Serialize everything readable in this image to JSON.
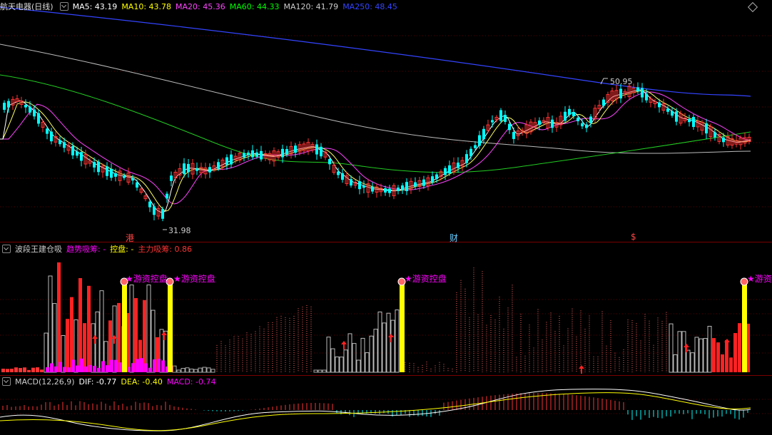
{
  "main": {
    "title": "航天电器(日线)",
    "ma": [
      {
        "label": "MA5: 43.19",
        "color": "#ffffff"
      },
      {
        "label": "MA10: 43.78",
        "color": "#ffff00"
      },
      {
        "label": "MA20: 45.36",
        "color": "#ff44ff"
      },
      {
        "label": "MA60: 44.33",
        "color": "#00ff00"
      },
      {
        "label": "MA120: 41.79",
        "color": "#cccccc"
      },
      {
        "label": "MA250: 48.45",
        "color": "#3344ff"
      }
    ],
    "high_label": "50.95",
    "low_label": "31.98",
    "markers": [
      "港",
      "财",
      "$"
    ]
  },
  "ind1": {
    "name": "波段王建仓吸",
    "t1": "趋势吸筹: -",
    "t2": "控盘: -",
    "t3": "主力吸筹: 0.86",
    "signal": "★游资控盘",
    "signal_cut": "★游资"
  },
  "ind2": {
    "name": "MACD(12,26,9)",
    "dif": "DIF: -0.77",
    "dea": "DEA: -0.40",
    "macd": "MACD: -0.74"
  },
  "colors": {
    "up": "#ff3333",
    "down": "#00ffff",
    "separator": "#7a0000",
    "magenta": "#ff00ff",
    "yellow": "#ffff00"
  }
}
